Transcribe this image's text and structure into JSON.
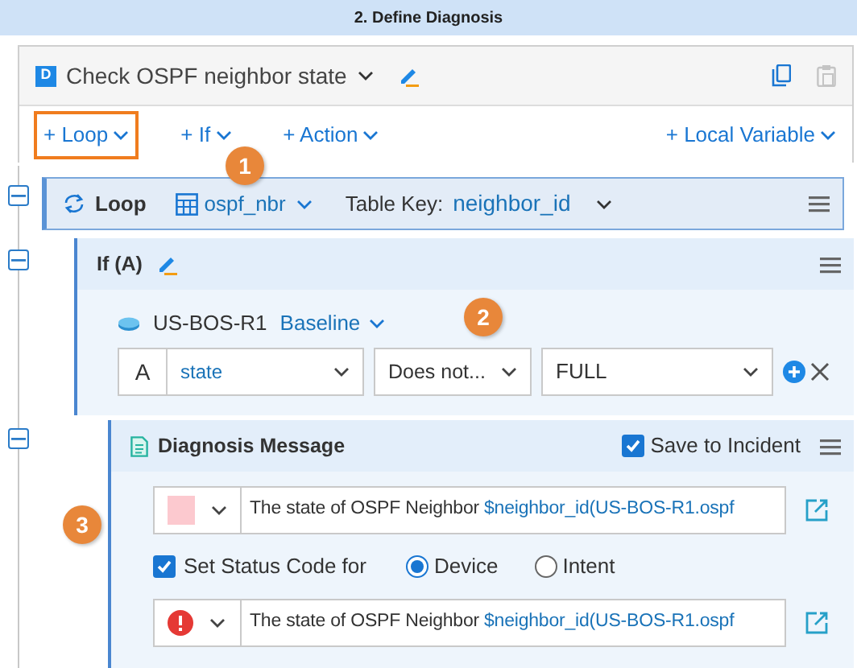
{
  "step_banner": {
    "title": "2. Define Diagnosis"
  },
  "diagnosis": {
    "badge": "D",
    "title": "Check OSPF neighbor state"
  },
  "toolbar": [
    {
      "label": "+ Loop",
      "highlighted": true
    },
    {
      "label": "+ If",
      "highlighted": false
    },
    {
      "label": "+ Action",
      "highlighted": false
    },
    {
      "label": "+ Local Variable",
      "highlighted": false
    }
  ],
  "loop": {
    "label": "Loop",
    "expanded": true,
    "table": "ospf_nbr",
    "table_key_label": "Table Key:",
    "table_key": "neighbor_id"
  },
  "if_block": {
    "title": "If (A)",
    "expanded": true,
    "device": "US-BOS-R1",
    "data_source": "Baseline",
    "conditions": [
      {
        "letter": "A",
        "field": "state",
        "operator": "Does not...",
        "value": "FULL"
      }
    ]
  },
  "message": {
    "title": "Diagnosis Message",
    "expanded": true,
    "save_to_incident": {
      "label": "Save to Incident",
      "checked": true
    },
    "rows": [
      {
        "kind": "color",
        "color": "#fcc9cf",
        "text": "The state of OSPF Neighbor",
        "variable": "$neighbor_id(US-BOS-R1.ospf"
      },
      {
        "kind": "error",
        "text": "The state of OSPF Neighbor",
        "variable": "$neighbor_id(US-BOS-R1.ospf"
      }
    ],
    "set_status": {
      "label": "Set Status Code for",
      "checked": true
    },
    "targets": [
      {
        "label": "Device",
        "selected": true
      },
      {
        "label": "Intent",
        "selected": false
      }
    ]
  },
  "callouts": [
    {
      "number": "1"
    },
    {
      "number": "2"
    },
    {
      "number": "3"
    }
  ]
}
